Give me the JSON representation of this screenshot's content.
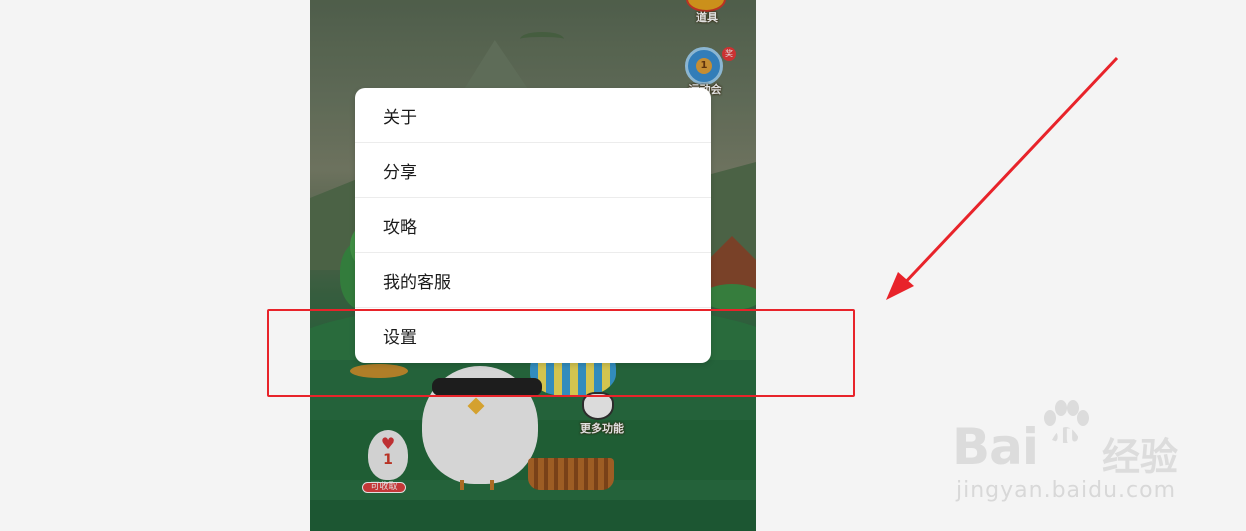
{
  "game": {
    "tools_label": "道具",
    "medal_value": "1",
    "medal_badge": "奖",
    "sports_label": "运动会",
    "more_features_label": "更多功能",
    "egg_count": "1",
    "collect_label": "可收取"
  },
  "menu": {
    "items": [
      {
        "label": "关于"
      },
      {
        "label": "分享"
      },
      {
        "label": "攻略"
      },
      {
        "label": "我的客服"
      },
      {
        "label": "设置"
      }
    ]
  },
  "annotation": {
    "color": "#e8232a",
    "highlighted_item": "设置"
  },
  "watermark": {
    "brand": "Bai",
    "brand_suffix": "du",
    "product": "经验",
    "url": "jingyan.baidu.com"
  }
}
